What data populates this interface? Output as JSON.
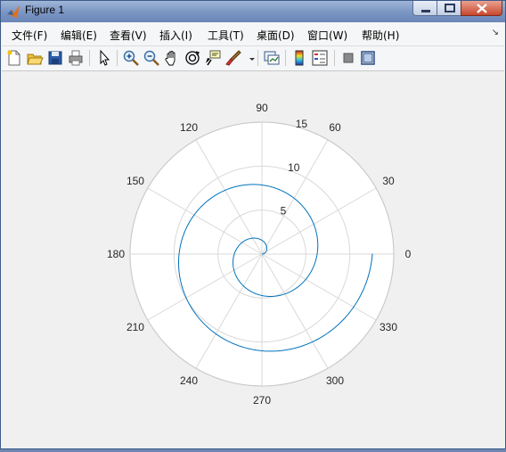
{
  "window": {
    "title": "Figure 1"
  },
  "menu": {
    "items": [
      "文件(F)",
      "编辑(E)",
      "查看(V)",
      "插入(I)",
      "工具(T)",
      "桌面(D)",
      "窗口(W)",
      "帮助(H)"
    ],
    "overflow_glyph": "↘"
  },
  "toolbar": {
    "buttons": [
      "new-figure-icon",
      "open-file-icon",
      "save-icon",
      "print-icon",
      "pointer-icon",
      "zoom-in-icon",
      "zoom-out-icon",
      "pan-hand-icon",
      "rotate-3d-icon",
      "data-cursor-icon",
      "brush-icon",
      "link-plot-icon",
      "colorbar-icon",
      "legend-icon",
      "hide-plot-tools-icon",
      "show-plot-tools-icon"
    ]
  },
  "colors": {
    "line": "#0072bd",
    "grid": "#d9d9d9",
    "axes_bg": "#ffffff",
    "figure_bg": "#f0f0f0"
  },
  "chart_data": {
    "type": "line",
    "coordinate_system": "polar",
    "theta_ticks": [
      "0",
      "30",
      "60",
      "90",
      "120",
      "150",
      "180",
      "210",
      "240",
      "270",
      "300",
      "330"
    ],
    "r_ticks": [
      "5",
      "10",
      "15"
    ],
    "rlim": [
      0,
      15
    ],
    "grid": true,
    "series": [
      {
        "equation": "r = theta",
        "theta_range_rad": [
          0,
          12.57
        ],
        "approx_points": {
          "theta_rad": [
            0,
            1.57,
            3.14,
            4.71,
            6.28,
            7.85,
            9.42,
            10.99,
            12.57
          ],
          "r": [
            0,
            1.57,
            3.14,
            4.71,
            6.28,
            7.85,
            9.42,
            10.99,
            12.57
          ]
        }
      }
    ]
  }
}
